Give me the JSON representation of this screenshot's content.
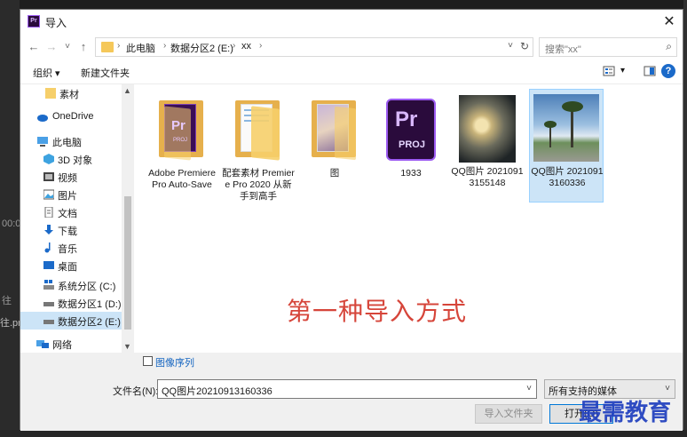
{
  "background": {
    "left_texts": [
      "00:0",
      "往",
      "往.pr"
    ]
  },
  "window": {
    "app_badge": "Pr",
    "title": "导入",
    "close_glyph": "✕"
  },
  "nav": {
    "back": "←",
    "forward": "→",
    "recent": "˅",
    "up": "↑",
    "breadcrumbs": [
      "此电脑",
      "数据分区2 (E:)",
      "xx"
    ],
    "separator": "›",
    "dropdown": "˅",
    "refresh": "↻",
    "search_placeholder": "搜索\"xx\"",
    "search_icon": "⌕"
  },
  "toolbar": {
    "organize": "组织 ▾",
    "new_folder": "新建文件夹",
    "view_dropdown": "▾",
    "help": "?"
  },
  "sidebar": {
    "items": [
      {
        "label": "素材",
        "icon": "folder-icon"
      },
      {
        "label": "OneDrive",
        "icon": "cloud-icon"
      },
      {
        "label": "此电脑",
        "icon": "computer-icon"
      },
      {
        "label": "3D 对象",
        "icon": "cube-icon"
      },
      {
        "label": "视频",
        "icon": "video-icon"
      },
      {
        "label": "图片",
        "icon": "picture-icon"
      },
      {
        "label": "文档",
        "icon": "document-icon"
      },
      {
        "label": "下载",
        "icon": "download-icon"
      },
      {
        "label": "音乐",
        "icon": "music-icon"
      },
      {
        "label": "桌面",
        "icon": "desktop-icon"
      },
      {
        "label": "系统分区 (C:)",
        "icon": "drive-icon"
      },
      {
        "label": "数据分区1 (D:)",
        "icon": "drive-icon"
      },
      {
        "label": "数据分区2 (E:)",
        "icon": "drive-icon"
      },
      {
        "label": "网络",
        "icon": "network-icon"
      }
    ]
  },
  "files": [
    {
      "name": "Adobe Premiere Pro Auto-Save",
      "kind": "folder-pr"
    },
    {
      "name": "配套素材 Premiere Pro 2020 从新手到高手",
      "kind": "folder-doc"
    },
    {
      "name": "图",
      "kind": "folder-photo"
    },
    {
      "name": "1933",
      "kind": "prproj"
    },
    {
      "name": "QQ图片 20210913155148",
      "kind": "image-flowers"
    },
    {
      "name": "QQ图片 20210913160336",
      "kind": "image-palms"
    }
  ],
  "prproj_icon": {
    "big": "Pr",
    "small": "PROJ"
  },
  "annotation": "第一种导入方式",
  "footer": {
    "image_sequence_label": "图像序列",
    "filename_label": "文件名(N):",
    "filename_value": "QQ图片20210913160336",
    "dropdown": "˅",
    "filetype_value": "所有支持的媒体",
    "import_folder_button": "导入文件夹",
    "open_button": "打开(O)"
  },
  "watermark": "最需教育"
}
